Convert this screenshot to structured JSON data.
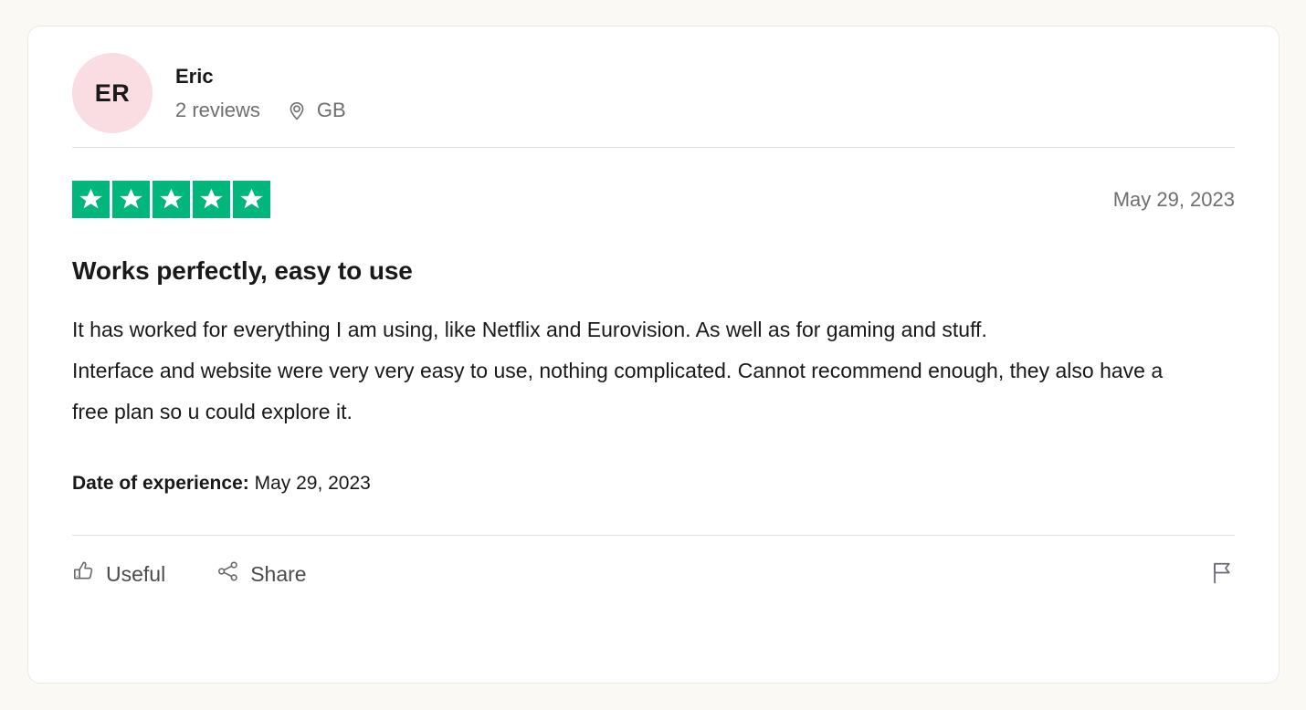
{
  "theme": {
    "page_background": "#faf9f4",
    "card_background": "#ffffff",
    "card_border": "#ebe9e1",
    "star_green": "#00b67a",
    "avatar_background": "#fadce3",
    "text_primary": "#191919",
    "text_muted": "#6f6f6f",
    "divider": "#e3e2dd"
  },
  "review_card": {
    "consumer": {
      "initials": "ER",
      "name": "Eric",
      "reviews_count_label": "2 reviews",
      "country_code": "GB",
      "location_icon": "map-pin-icon"
    },
    "rating": {
      "value": 5,
      "max": 5,
      "star_icon": "star-icon",
      "label": "Rated 5 out of 5 stars"
    },
    "published_date": "May 29, 2023",
    "title": "Works perfectly, easy to use",
    "body": "It has worked for everything I am using, like Netflix and Eurovision. As well as for gaming and stuff.\nInterface and website were very very easy to use, nothing complicated. Cannot recommend enough, they also have a free plan so u could explore it.",
    "date_of_experience": {
      "label": "Date of experience:",
      "value": "May 29, 2023"
    },
    "actions": {
      "useful": {
        "label": "Useful",
        "icon": "thumbs-up-icon"
      },
      "share": {
        "label": "Share",
        "icon": "share-icon"
      },
      "report": {
        "icon": "flag-icon"
      }
    }
  }
}
